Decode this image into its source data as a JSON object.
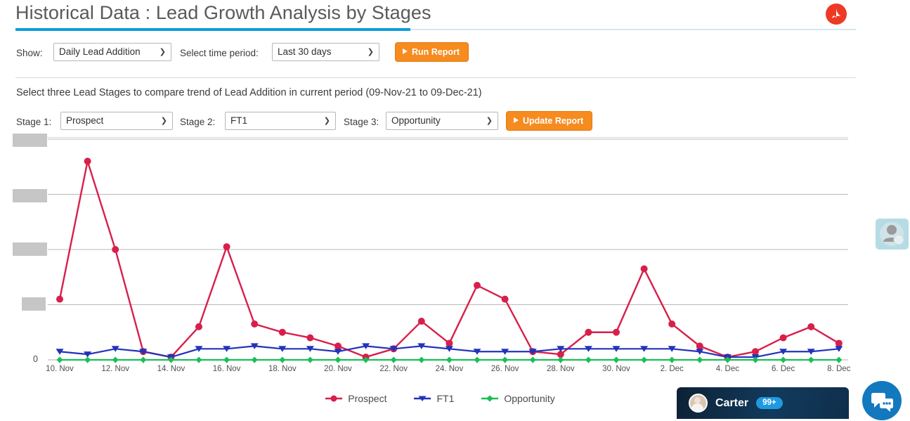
{
  "header": {
    "title": "Historical Data : Lead Growth Analysis by Stages",
    "accent_color": "#0d9ddb",
    "pdf_icon": "pdf-export-icon"
  },
  "controls": {
    "show_label": "Show:",
    "show_value": "Daily Lead Addition",
    "time_period_label": "Select time period:",
    "time_period_value": "Last 30 days",
    "run_report_label": "Run Report"
  },
  "stage_selector": {
    "description": "Select three Lead Stages to compare trend of Lead Addition in current period (09-Nov-21 to 09-Dec-21)",
    "stage1_label": "Stage 1:",
    "stage1_value": "Prospect",
    "stage2_label": "Stage 2:",
    "stage2_value": "FT1",
    "stage3_label": "Stage 3:",
    "stage3_value": "Opportunity",
    "update_report_label": "Update Report"
  },
  "chart_data": {
    "type": "line",
    "title": "",
    "xlabel": "",
    "ylabel": "",
    "grid": true,
    "legend_position": "bottom",
    "y_axis_zero_label": "0",
    "y_axis_labels_redacted": true,
    "y_axis_redacted_count": 4,
    "ylim": [
      0,
      100
    ],
    "gridline_values": [
      20,
      40,
      60,
      80
    ],
    "x": [
      "10. Nov",
      "11. Nov",
      "12. Nov",
      "13. Nov",
      "14. Nov",
      "15. Nov",
      "16. Nov",
      "17. Nov",
      "18. Nov",
      "19. Nov",
      "20. Nov",
      "21. Nov",
      "22. Nov",
      "23. Nov",
      "24. Nov",
      "25. Nov",
      "26. Nov",
      "27. Nov",
      "28. Nov",
      "29. Nov",
      "30. Nov",
      "1. Dec",
      "2. Dec",
      "3. Dec",
      "4. Dec",
      "5. Dec",
      "6. Dec",
      "7. Dec",
      "8. Dec"
    ],
    "xticks": [
      "10. Nov",
      "12. Nov",
      "14. Nov",
      "16. Nov",
      "18. Nov",
      "20. Nov",
      "22. Nov",
      "24. Nov",
      "26. Nov",
      "28. Nov",
      "30. Nov",
      "2. Dec",
      "4. Dec",
      "6. Dec",
      "8. Dec"
    ],
    "series": [
      {
        "name": "Prospect",
        "color": "#d81f4a",
        "marker": "circle",
        "values": [
          22,
          72,
          40,
          3,
          1,
          12,
          41,
          13,
          10,
          8,
          5,
          1,
          4,
          14,
          6,
          27,
          22,
          3,
          2,
          10,
          10,
          33,
          13,
          5,
          1,
          3,
          8,
          12,
          6
        ]
      },
      {
        "name": "FT1",
        "color": "#2233bb",
        "marker": "triangle-down",
        "values": [
          3,
          2,
          4,
          3,
          1,
          4,
          4,
          5,
          4,
          4,
          3,
          5,
          4,
          5,
          4,
          3,
          3,
          3,
          4,
          4,
          4,
          4,
          4,
          3,
          1,
          1,
          3,
          3,
          4
        ]
      },
      {
        "name": "Opportunity",
        "color": "#18c054",
        "marker": "diamond",
        "values": [
          0,
          0,
          0,
          0,
          0,
          0,
          0,
          0,
          0,
          0,
          0,
          0,
          0,
          0,
          0,
          0,
          0,
          0,
          0,
          0,
          0,
          0,
          0,
          0,
          0,
          0,
          0,
          0,
          0
        ]
      }
    ]
  },
  "chat": {
    "name": "Carter",
    "badge": "99+",
    "fab_icon": "chat-bubbles-icon",
    "avatar_icon": "user-avatar"
  },
  "side_widget": {
    "icon": "person-avatar-icon"
  }
}
